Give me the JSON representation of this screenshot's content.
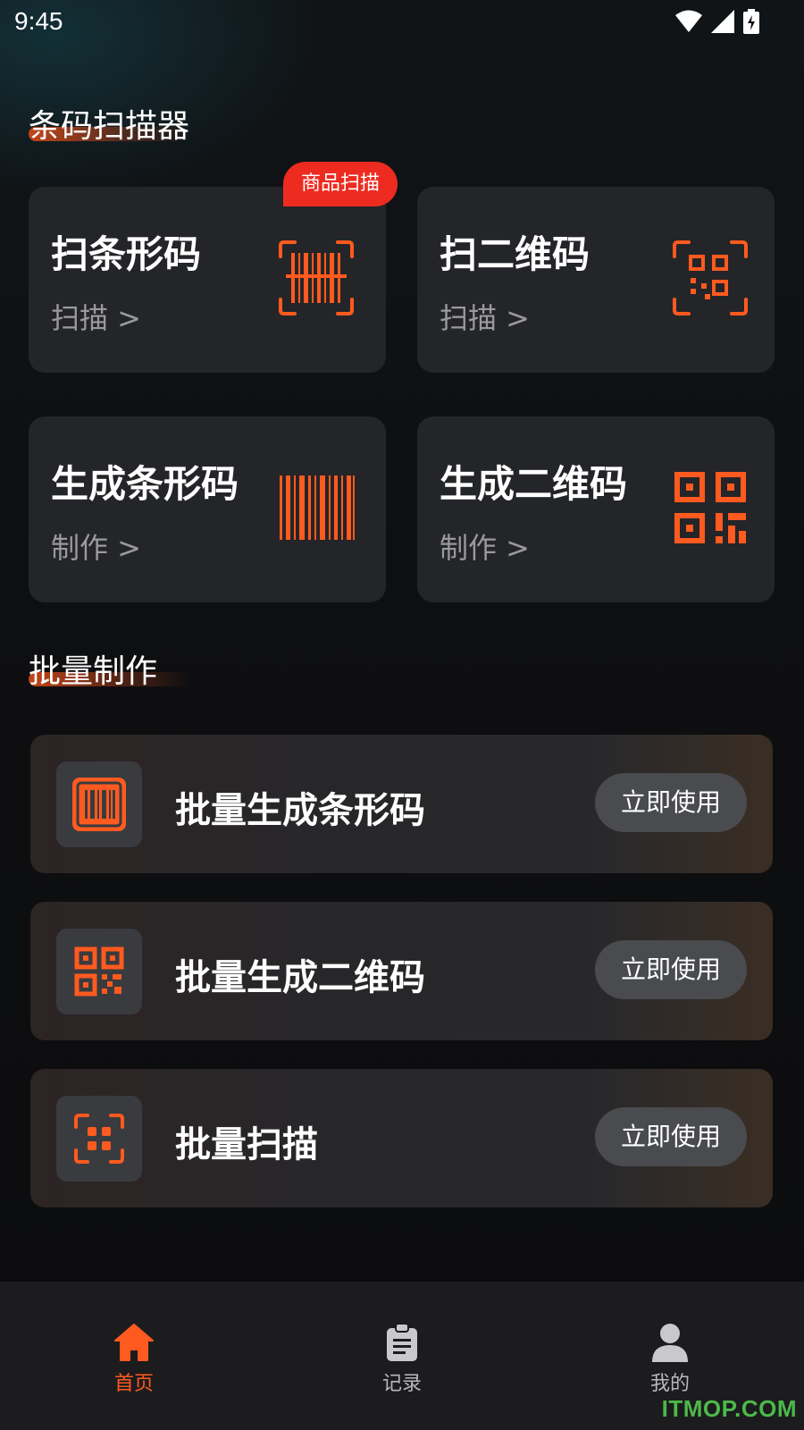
{
  "status_bar": {
    "time": "9:45"
  },
  "sections": {
    "scanner_title": "条码扫描器",
    "batch_title": "批量制作"
  },
  "cards": [
    {
      "title": "扫条形码",
      "action": "扫描 >",
      "icon": "barcode-scan-icon",
      "badge": "商品扫描"
    },
    {
      "title": "扫二维码",
      "action": "扫描 >",
      "icon": "qrcode-scan-icon"
    },
    {
      "title": "生成条形码",
      "action": "制作 >",
      "icon": "barcode-icon"
    },
    {
      "title": "生成二维码",
      "action": "制作 >",
      "icon": "qrcode-icon"
    }
  ],
  "batch": [
    {
      "label": "批量生成条形码",
      "button": "立即使用",
      "icon": "barcode-icon"
    },
    {
      "label": "批量生成二维码",
      "button": "立即使用",
      "icon": "qrcode-icon"
    },
    {
      "label": "批量扫描",
      "button": "立即使用",
      "icon": "scan-frame-icon"
    }
  ],
  "tabbar": [
    {
      "label": "首页",
      "icon": "home-icon",
      "active": true
    },
    {
      "label": "记录",
      "icon": "clipboard-icon",
      "active": false
    },
    {
      "label": "我的",
      "icon": "user-icon",
      "active": false
    }
  ],
  "watermark": "ITMOP.COM",
  "colors": {
    "accent": "#ff5a1f",
    "badge": "#ee2b21",
    "card": "#242528",
    "background": "#0d0d0f",
    "watermark": "#4cb84a"
  }
}
